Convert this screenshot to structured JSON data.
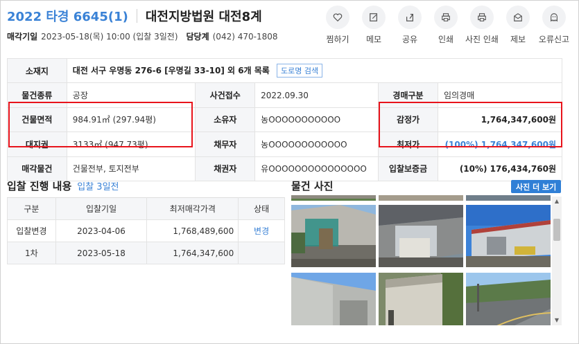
{
  "header": {
    "case_no": "2022 타경 6645(1)",
    "court": "대전지방법원 대전8계",
    "sale_date_label": "매각기일",
    "sale_date": "2023-05-18(목) 10:00 (입찰 3일전)",
    "dept_label": "담당계",
    "dept_phone": "(042) 470-1808"
  },
  "actions": [
    {
      "label": "찜하기",
      "icon": "heart-icon"
    },
    {
      "label": "메모",
      "icon": "memo-icon"
    },
    {
      "label": "공유",
      "icon": "share-icon"
    },
    {
      "label": "인쇄",
      "icon": "print-icon"
    },
    {
      "label": "사진 인쇄",
      "icon": "photo-print-icon"
    },
    {
      "label": "제보",
      "icon": "report-mail-icon"
    },
    {
      "label": "오류신고",
      "icon": "ghost-icon"
    }
  ],
  "info": {
    "location_label": "소재지",
    "location": "대전 서구 우명동 276-6 [우명길 33-10] 외 6개 목록",
    "road_btn": "도로명 검색",
    "type_label": "물건종류",
    "type": "공장",
    "filed_label": "사건접수",
    "filed": "2022.09.30",
    "auction_type_label": "경매구분",
    "auction_type": "임의경매",
    "building_area_label": "건물면적",
    "building_area": "984.91㎡ (297.94평)",
    "owner_label": "소유자",
    "owner": "농OOOOOOOOOOO",
    "appraisal_label": "감정가",
    "appraisal": "1,764,347,600원",
    "land_right_label": "대지권",
    "land_right": "3133㎡ (947.73평)",
    "debtor_label": "채무자",
    "debtor": "농OOOOOOOOOOOO",
    "min_price_label": "최저가",
    "min_price": "(100%) 1,764,347,600원",
    "sale_items_label": "매각물건",
    "sale_items": "건물전부, 토지전부",
    "creditor_label": "채권자",
    "creditor": "유OOOOOOOOOOOOOOO",
    "deposit_label": "입찰보증금",
    "deposit": "(10%) 176,434,760원"
  },
  "bid_section": {
    "title": "입찰 진행 내용",
    "tag": "입찰 3일전",
    "columns": [
      "구분",
      "입찰기일",
      "최저매각가격",
      "상태"
    ],
    "rows": [
      {
        "kind": "입찰변경",
        "date": "2023-04-06",
        "price": "1,768,489,600",
        "status": "변경"
      },
      {
        "kind": "1차",
        "date": "2023-05-18",
        "price": "1,764,347,600",
        "status": ""
      }
    ]
  },
  "photo_section": {
    "title": "물건 사진",
    "more_btn": "사진 더 보기"
  },
  "colors": {
    "accent": "#3a82d6",
    "highlight_border": "#e8131b",
    "header_cell_bg": "#f5f6f8"
  }
}
